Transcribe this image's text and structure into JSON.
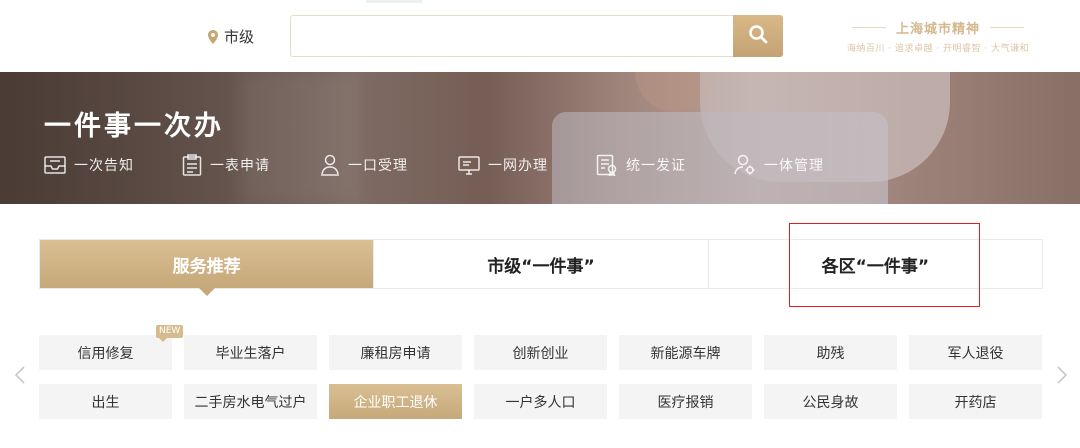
{
  "header": {
    "location": "市级",
    "search_placeholder": "",
    "spirit_title": "上海城市精神",
    "spirit_subtitle": "海纳百川 · 追求卓越 · 开明睿智 · 大气谦和"
  },
  "banner": {
    "title": "一件事一次办",
    "features": [
      {
        "label": "一次告知",
        "icon": "inbox-icon"
      },
      {
        "label": "一表申请",
        "icon": "clipboard-icon"
      },
      {
        "label": "一口受理",
        "icon": "person-icon"
      },
      {
        "label": "一网办理",
        "icon": "monitor-icon"
      },
      {
        "label": "统一发证",
        "icon": "certificate-icon"
      },
      {
        "label": "一体管理",
        "icon": "user-gear-icon"
      }
    ]
  },
  "tabs": [
    {
      "label": "服务推荐",
      "active": true
    },
    {
      "label": "市级“一件事”",
      "active": false
    },
    {
      "label": "各区“一件事”",
      "active": false
    }
  ],
  "services": {
    "new_badge": "NEW",
    "items": [
      "信用修复",
      "毕业生落户",
      "廉租房申请",
      "创新创业",
      "新能源车牌",
      "助残",
      "军人退役",
      "出生",
      "二手房水电气过户",
      "企业职工退休",
      "一户多人口",
      "医疗报销",
      "公民身故",
      "开药店"
    ],
    "highlighted": "企业职工退休"
  },
  "colors": {
    "accent": "#c6a97a",
    "accent_light": "#d9bf93",
    "annotation": "#e02020"
  }
}
